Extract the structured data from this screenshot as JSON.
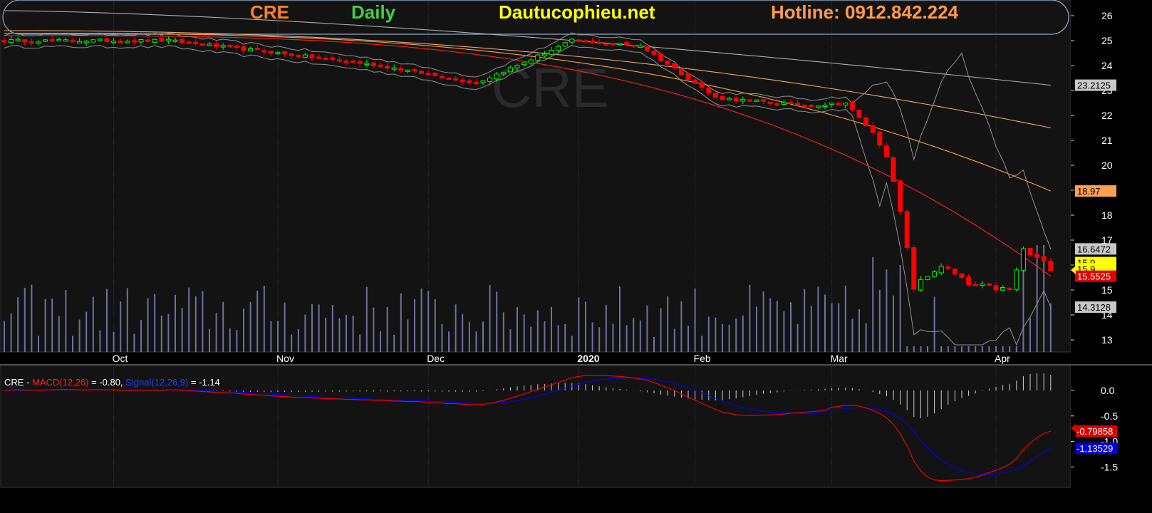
{
  "header": {
    "symbol": "CRE",
    "interval": "Daily",
    "site": "Dautucophieu.net",
    "hotline": "Hotline: 0912.842.224",
    "symbol_color": "#ff7f27",
    "interval_color": "#3ecf3e",
    "site_color": "#ffff00",
    "hotline_color": "#ff9a4a"
  },
  "watermark": "CRE",
  "price_panel": {
    "y_ticks": [
      "26",
      "25",
      "24",
      "23",
      "22",
      "21",
      "20",
      "19",
      "18",
      "17",
      "16",
      "15",
      "14",
      "13"
    ],
    "x_ticks": [
      "Oct",
      "Nov",
      "Dec",
      "2020",
      "Feb",
      "Mar",
      "Apr"
    ],
    "value_labels": [
      {
        "text": "23.2125",
        "value": 23.2125,
        "bg": "#c8c8c8",
        "fg": "#000000"
      },
      {
        "text": "18.97",
        "value": 18.97,
        "bg": "#ffa050",
        "fg": "#000000"
      },
      {
        "text": "16.6472",
        "value": 16.6472,
        "bg": "#c8c8c8",
        "fg": "#000000"
      },
      {
        "text": "15.9",
        "value": 16.1,
        "bg": "#ffff00",
        "fg": "#000000"
      },
      {
        "text": "15.9",
        "value": 15.85,
        "bg": "#ffff00",
        "fg": "#000000"
      },
      {
        "text": "15.5525",
        "value": 15.5525,
        "bg": "#e00000",
        "fg": "#ffffff"
      },
      {
        "text": "14.3128",
        "value": 14.3128,
        "bg": "#c8c8c8",
        "fg": "#000000"
      }
    ]
  },
  "macd_panel": {
    "legend": {
      "symbol": "CRE",
      "sep1": " - ",
      "macd_name": "MACD(12,26)",
      "macd_value": " = -0.80, ",
      "signal_name": "Signal(12,26,9)",
      "signal_value": " = -1.14"
    },
    "y_ticks": [
      "0.0",
      "-0.5",
      "-1.0",
      "-1.5"
    ],
    "value_labels": [
      {
        "text": "-0.79858",
        "value": -0.79858,
        "bg": "#e00000",
        "fg": "#ffffff"
      },
      {
        "text": "-1.13529",
        "value": -1.13529,
        "bg": "#0000e0",
        "fg": "#ffffff"
      }
    ]
  },
  "colors": {
    "up": "#00ff00",
    "down": "#ff0000",
    "volume": "#7070a0",
    "ma_red": "#ff2020",
    "ma_orange": "#ffa040",
    "ma_peach": "#e8a870",
    "ma_gray": "#b0b0b0",
    "band": "#909090",
    "macd_line": "#ff0000",
    "signal_line": "#0000ff",
    "hist": "#d0d0d0"
  },
  "chart_data": {
    "type": "candlestick",
    "symbol": "CRE",
    "interval": "Daily",
    "ylim": [
      12.5,
      26.5
    ],
    "x_ticks": [
      {
        "label": "Oct",
        "index": 16
      },
      {
        "label": "Nov",
        "index": 40
      },
      {
        "label": "Dec",
        "index": 62
      },
      {
        "label": "2020",
        "index": 84
      },
      {
        "label": "Feb",
        "index": 101
      },
      {
        "label": "Mar",
        "index": 121
      },
      {
        "label": "Apr",
        "index": 145
      }
    ],
    "key_points": [
      {
        "index": 0,
        "close": 25.0
      },
      {
        "index": 24,
        "close": 25.0
      },
      {
        "index": 40,
        "close": 24.5
      },
      {
        "index": 55,
        "close": 24.0
      },
      {
        "index": 69,
        "close": 23.3
      },
      {
        "index": 75,
        "close": 24.0
      },
      {
        "index": 83,
        "close": 25.0
      },
      {
        "index": 93,
        "close": 24.8
      },
      {
        "index": 100,
        "close": 23.5
      },
      {
        "index": 104,
        "close": 22.7
      },
      {
        "index": 118,
        "close": 22.4
      },
      {
        "index": 123,
        "close": 22.5
      },
      {
        "index": 127,
        "close": 21.3
      },
      {
        "index": 129,
        "close": 20.4
      },
      {
        "index": 131,
        "close": 18.1
      },
      {
        "index": 133,
        "close": 15.1
      },
      {
        "index": 137,
        "close": 16.0
      },
      {
        "index": 141,
        "close": 15.2
      },
      {
        "index": 147,
        "close": 15.0
      },
      {
        "index": 149,
        "close": 16.6
      },
      {
        "index": 153,
        "close": 15.9
      }
    ],
    "moving_averages": [
      {
        "color": "#ff2020",
        "start": 25.2,
        "end": 15.5525
      },
      {
        "color": "#ffa040",
        "start": 25.3,
        "end": 18.97
      },
      {
        "color": "#e8a870",
        "start": 25.4,
        "end": 21.5
      },
      {
        "color": "#b0b0b0",
        "start": 26.2,
        "end": 23.2125
      }
    ],
    "bollinger_last": {
      "upper": 16.6472,
      "lower": 14.3128
    },
    "last_close": 15.9,
    "macd": {
      "macd": -0.79858,
      "signal": -1.13529,
      "ylim": [
        -1.95,
        0.35
      ]
    }
  }
}
